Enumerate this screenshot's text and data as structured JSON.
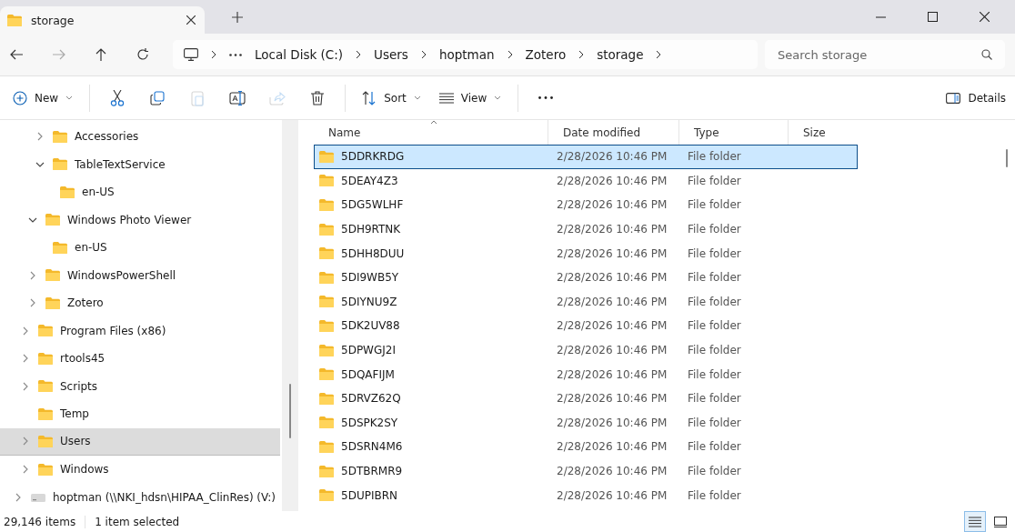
{
  "tab": {
    "title": "storage",
    "selected": true
  },
  "breadcrumb": [
    "Local Disk (C:)",
    "Users",
    "hoptman",
    "Zotero",
    "storage"
  ],
  "search": {
    "placeholder": "Search storage"
  },
  "toolbar": [
    {
      "kind": "new",
      "label": "New",
      "disabled": false
    },
    {
      "kind": "cut",
      "disabled": false
    },
    {
      "kind": "copy",
      "disabled": false
    },
    {
      "kind": "paste",
      "disabled": true
    },
    {
      "kind": "rename",
      "disabled": false
    },
    {
      "kind": "share",
      "disabled": true
    },
    {
      "kind": "delete",
      "disabled": false
    },
    {
      "kind": "sort",
      "label": "Sort",
      "disabled": false
    },
    {
      "kind": "view",
      "label": "View",
      "disabled": false
    },
    {
      "kind": "more",
      "disabled": false
    }
  ],
  "details_button": {
    "label": "Details"
  },
  "tree": [
    {
      "children": [
        {
          "children": [
            {
              "children": [
                {
                  "label": "Accessories",
                  "expanded": false,
                  "selected": false
                },
                {
                  "label": "TableTextService",
                  "expanded": true,
                  "selected": false,
                  "children": [
                    {
                      "label": "en-US",
                      "selected": false
                    }
                  ]
                }
              ]
            },
            {
              "label": "Windows Photo Viewer",
              "expanded": true,
              "selected": false,
              "children": [
                {
                  "label": "en-US",
                  "selected": false
                }
              ]
            },
            {
              "label": "WindowsPowerShell",
              "expanded": false,
              "selected": false
            },
            {
              "label": "Zotero",
              "expanded": false,
              "selected": false
            }
          ]
        },
        {
          "label": "Program Files (x86)",
          "expanded": false,
          "selected": false
        },
        {
          "label": "rtools45",
          "expanded": false,
          "selected": false
        },
        {
          "label": "Scripts",
          "expanded": false,
          "selected": false
        },
        {
          "label": "Temp",
          "selected": false
        },
        {
          "label": "Users",
          "expanded": false,
          "selected": true
        },
        {
          "label": "Windows",
          "expanded": false,
          "selected": false
        }
      ]
    },
    {
      "label": "hoptman (\\\\NKI_hdsn\\HIPAA_ClinRes) (V:)",
      "kind": "drive",
      "expanded": false,
      "selected": false
    }
  ],
  "table": {
    "columns": [
      "Name",
      "Date modified",
      "Type",
      "Size"
    ],
    "rows": [
      {
        "name": "5DDRKRDG",
        "date": "2/28/2026 10:46 PM",
        "type": "File folder",
        "selected": true
      },
      {
        "name": "5DEAY4Z3",
        "date": "2/28/2026 10:46 PM",
        "type": "File folder",
        "selected": false
      },
      {
        "name": "5DG5WLHF",
        "date": "2/28/2026 10:46 PM",
        "type": "File folder",
        "selected": false
      },
      {
        "name": "5DH9RTNK",
        "date": "2/28/2026 10:46 PM",
        "type": "File folder",
        "selected": false
      },
      {
        "name": "5DHH8DUU",
        "date": "2/28/2026 10:46 PM",
        "type": "File folder",
        "selected": false
      },
      {
        "name": "5DI9WB5Y",
        "date": "2/28/2026 10:46 PM",
        "type": "File folder",
        "selected": false
      },
      {
        "name": "5DIYNU9Z",
        "date": "2/28/2026 10:46 PM",
        "type": "File folder",
        "selected": false
      },
      {
        "name": "5DK2UV88",
        "date": "2/28/2026 10:46 PM",
        "type": "File folder",
        "selected": false
      },
      {
        "name": "5DPWGJ2I",
        "date": "2/28/2026 10:46 PM",
        "type": "File folder",
        "selected": false
      },
      {
        "name": "5DQAFIJM",
        "date": "2/28/2026 10:46 PM",
        "type": "File folder",
        "selected": false
      },
      {
        "name": "5DRVZ62Q",
        "date": "2/28/2026 10:46 PM",
        "type": "File folder",
        "selected": false
      },
      {
        "name": "5DSPK2SY",
        "date": "2/28/2026 10:46 PM",
        "type": "File folder",
        "selected": false
      },
      {
        "name": "5DSRN4M6",
        "date": "2/28/2026 10:46 PM",
        "type": "File folder",
        "selected": false
      },
      {
        "name": "5DTBRMR9",
        "date": "2/28/2026 10:46 PM",
        "type": "File folder",
        "selected": false
      },
      {
        "name": "5DUPIBRN",
        "date": "2/28/2026 10:46 PM",
        "type": "File folder",
        "selected": false
      }
    ]
  },
  "status_bar": {
    "count": "29,146 items",
    "selection": "1 item selected",
    "views": [
      {
        "kind": "details",
        "selected": true
      },
      {
        "kind": "tiles",
        "selected": false
      }
    ]
  }
}
